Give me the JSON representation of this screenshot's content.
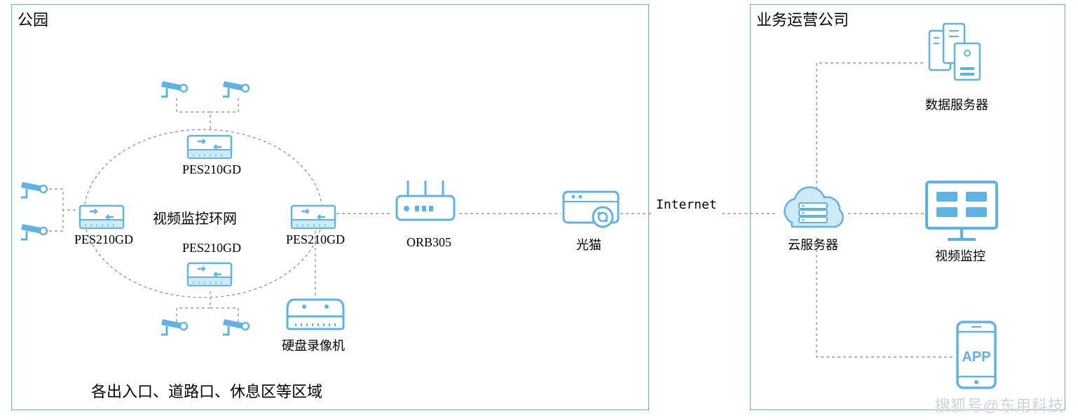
{
  "park": {
    "title": "公园",
    "ring_label": "视频监控环网",
    "switch_top": "PES210GD",
    "switch_left": "PES210GD",
    "switch_bottom": "PES210GD",
    "switch_right": "PES210GD",
    "nvr_label": "硬盘录像机",
    "footer": "各出入口、道路口、休息区等区域"
  },
  "router_label": "ORB305",
  "modem_label": "光猫",
  "internet_label": "Internet",
  "cloud_label": "云服务器",
  "company": {
    "title": "业务运营公司",
    "server_label": "数据服务器",
    "video_label": "视频监控",
    "app_label": "APP"
  },
  "watermark": "搜狐号@东用科技",
  "colors": {
    "primary": "#5eb3e4"
  }
}
